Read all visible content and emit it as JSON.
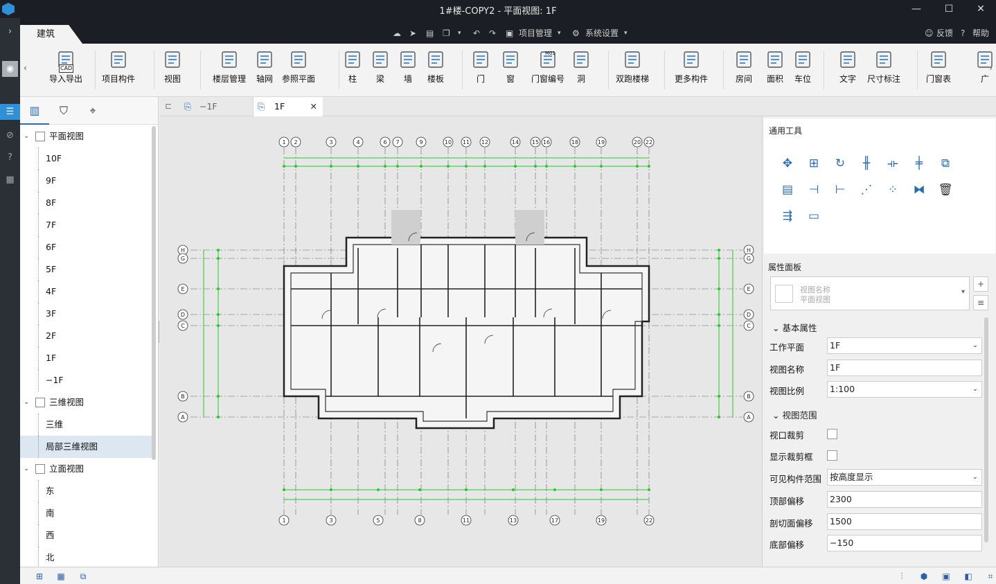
{
  "window": {
    "title": "1#楼-COPY2 - 平面视图: 1F",
    "min": "—",
    "max": "☐",
    "close": "✕"
  },
  "menubar": {
    "tab": "建筑",
    "project_mgmt": "项目管理",
    "settings": "系统设置",
    "feedback": "反馈",
    "help": "帮助"
  },
  "ribbon": [
    {
      "label": "导入导出",
      "icon": "cad-import-icon"
    },
    {
      "label": "项目构件",
      "icon": "project-component-icon"
    },
    {
      "label": "视图",
      "icon": "view-icon"
    },
    {
      "label": "楼层管理",
      "icon": "floor-manage-icon"
    },
    {
      "label": "轴网",
      "icon": "axis-grid-icon"
    },
    {
      "label": "参照平面",
      "icon": "ref-plane-icon"
    },
    {
      "label": "柱",
      "icon": "column-icon"
    },
    {
      "label": "梁",
      "icon": "beam-icon"
    },
    {
      "label": "墙",
      "icon": "wall-icon"
    },
    {
      "label": "楼板",
      "icon": "slab-icon"
    },
    {
      "label": "门",
      "icon": "door-icon"
    },
    {
      "label": "窗",
      "icon": "window-icon"
    },
    {
      "label": "门窗编号",
      "icon": "door-window-number-icon"
    },
    {
      "label": "洞",
      "icon": "opening-icon"
    },
    {
      "label": "双跑楼梯",
      "icon": "double-stair-icon"
    },
    {
      "label": "更多构件",
      "icon": "more-components-icon"
    },
    {
      "label": "房间",
      "icon": "room-icon"
    },
    {
      "label": "面积",
      "icon": "area-icon"
    },
    {
      "label": "车位",
      "icon": "parking-icon"
    },
    {
      "label": "文字",
      "icon": "text-icon"
    },
    {
      "label": "尺寸标注",
      "icon": "dimension-icon"
    },
    {
      "label": "门窗表",
      "icon": "door-window-table-icon"
    },
    {
      "label": "广",
      "icon": "more-icon"
    }
  ],
  "ribbon_cad_badge": "CAD",
  "ribbon_door_number_badge": "M01",
  "tree": {
    "sections": [
      {
        "label": "平面视图",
        "items": [
          "10F",
          "9F",
          "8F",
          "7F",
          "6F",
          "5F",
          "4F",
          "3F",
          "2F",
          "1F",
          "−1F"
        ]
      },
      {
        "label": "三维视图",
        "items": [
          "三维",
          "局部三维视图"
        ]
      },
      {
        "label": "立面视图",
        "items": [
          "东",
          "南",
          "西",
          "北"
        ]
      }
    ],
    "selected": "局部三维视图"
  },
  "doc_tabs": [
    {
      "label": "−1F"
    },
    {
      "label": "1F",
      "close": "✕"
    }
  ],
  "drawing": {
    "top_axes": [
      "1",
      "2",
      "3",
      "4",
      "6",
      "7",
      "9",
      "10",
      "11",
      "12",
      "14",
      "15",
      "16",
      "18",
      "19",
      "20",
      "22"
    ],
    "bottom_axes": [
      "1",
      "3",
      "5",
      "8",
      "11",
      "13",
      "17",
      "19",
      "22"
    ],
    "side_axes": [
      "H",
      "G",
      "E",
      "D",
      "C",
      "B",
      "A"
    ]
  },
  "tools_panel": {
    "title": "通用工具"
  },
  "props": {
    "title": "属性面板",
    "type_name": "视图名称",
    "type_value": "平面视图",
    "basic_section": "基本属性",
    "work_plane_label": "工作平面",
    "work_plane_value": "1F",
    "view_name_label": "视图名称",
    "view_name_value": "1F",
    "scale_label": "视图比例",
    "scale_value": "1:100",
    "range_section": "视图范围",
    "crop_label": "视口裁剪",
    "show_crop_label": "显示裁剪框",
    "visible_range_label": "可见构件范围",
    "visible_range_value": "按高度显示",
    "top_offset_label": "顶部偏移",
    "top_offset_value": "2300",
    "cut_offset_label": "剖切面偏移",
    "cut_offset_value": "1500",
    "bottom_offset_label": "底部偏移",
    "bottom_offset_value": "−150"
  },
  "colors": {
    "accent": "#2b6cb0",
    "dim_green": "#22cc22",
    "titlebar": "#1b1e24"
  }
}
